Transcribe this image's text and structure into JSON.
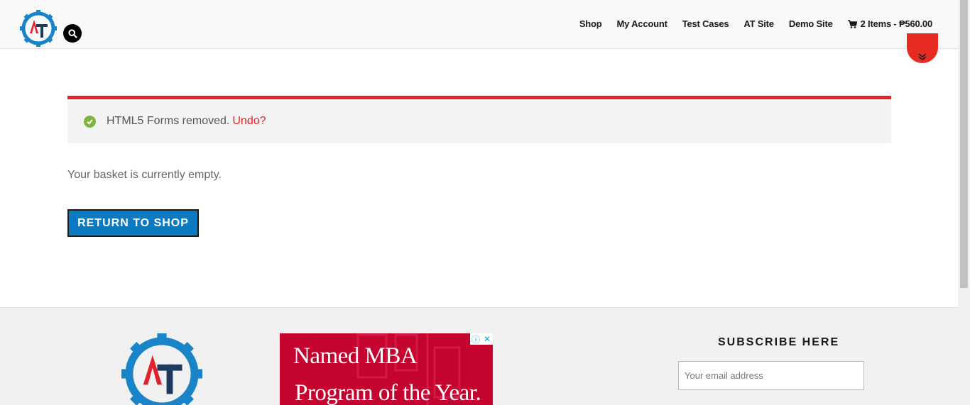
{
  "header": {
    "nav": [
      {
        "label": "Shop"
      },
      {
        "label": "My Account"
      },
      {
        "label": "Test Cases"
      },
      {
        "label": "AT Site"
      },
      {
        "label": "Demo Site"
      }
    ],
    "cart_label": "2 Items - ₱560.00"
  },
  "notice": {
    "message": "HTML5 Forms removed.",
    "undo_label": "Undo?"
  },
  "cart": {
    "empty_message": "Your basket is currently empty.",
    "return_button": "RETURN TO SHOP"
  },
  "footer": {
    "ad": {
      "line1": "Named MBA",
      "line2": "Program of the Year."
    },
    "subscribe_title": "SUBSCRIBE HERE",
    "email_placeholder": "Your email address"
  },
  "colors": {
    "brand_red": "#e2212a",
    "brand_blue": "#0a7bc2",
    "success_green": "#82b440",
    "ad_red": "#c4032f"
  }
}
